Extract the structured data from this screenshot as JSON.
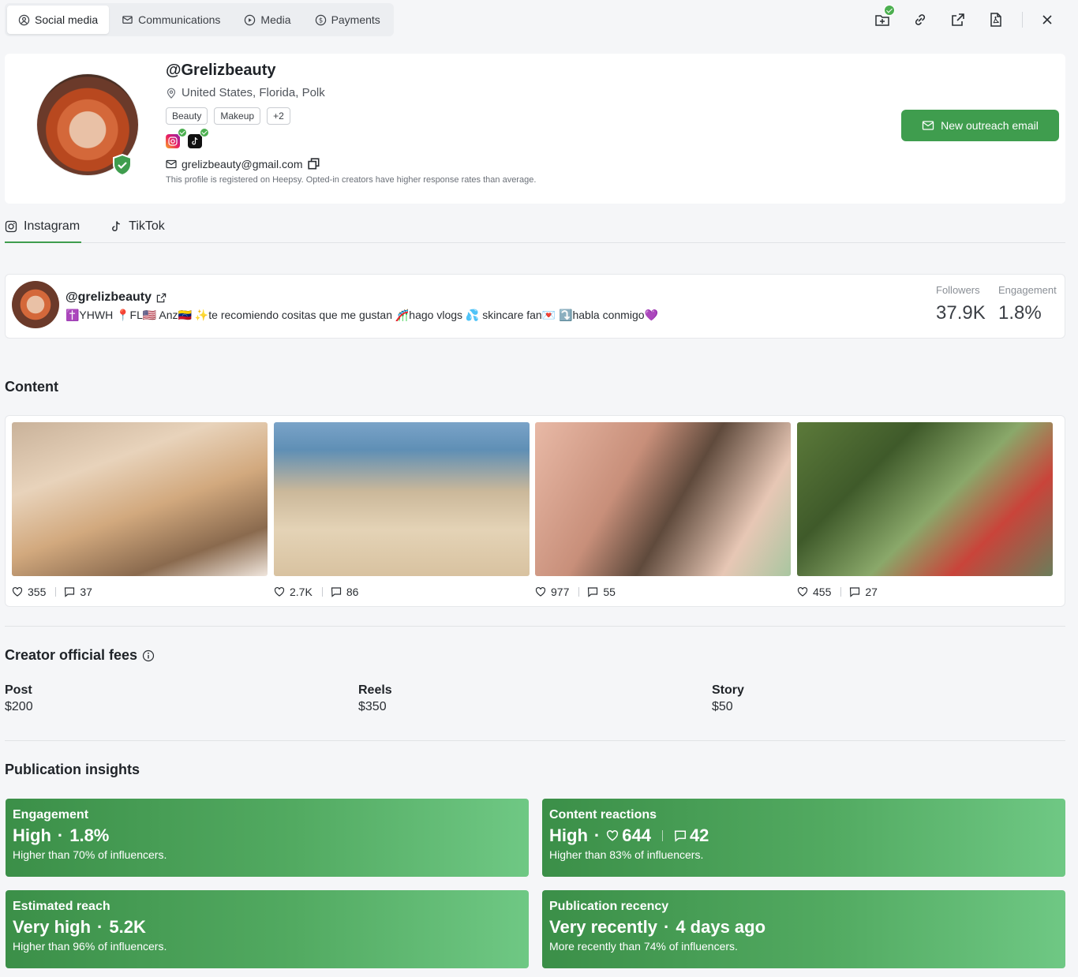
{
  "top_tabs": [
    {
      "label": "Social media",
      "icon": "social-icon",
      "active": true
    },
    {
      "label": "Communications",
      "icon": "communications-icon"
    },
    {
      "label": "Media",
      "icon": "media-play-icon"
    },
    {
      "label": "Payments",
      "icon": "dollar-icon"
    }
  ],
  "top_actions": [
    "add-to-list-icon",
    "link-icon",
    "external-link-icon",
    "pdf-export-icon",
    "close-icon"
  ],
  "profile": {
    "handle": "@Grelizbeauty",
    "location": "United States, Florida, Polk",
    "tags": [
      "Beauty",
      "Makeup",
      "+2"
    ],
    "email": "grelizbeauty@gmail.com",
    "note": "This profile is registered on Heepsy. Opted-in creators have higher response rates than average.",
    "outreach_button": "New outreach email"
  },
  "platform_tabs": [
    {
      "label": "Instagram",
      "active": true
    },
    {
      "label": "TikTok"
    }
  ],
  "account": {
    "handle": "@grelizbeauty",
    "bio": "✝️YHWH 📍FL🇺🇸 Anz🇻🇪 ✨te recomiendo cositas que me gustan 🎢hago vlogs 💦 skincare fan💌 ⤵️habla conmigo💜",
    "followers_label": "Followers",
    "followers_value": "37.9K",
    "engagement_label": "Engagement",
    "engagement_value": "1.8%"
  },
  "content": {
    "title": "Content",
    "posts": [
      {
        "likes": "355",
        "comments": "37"
      },
      {
        "likes": "2.7K",
        "comments": "86"
      },
      {
        "likes": "977",
        "comments": "55"
      },
      {
        "likes": "455",
        "comments": "27"
      }
    ]
  },
  "fees": {
    "title": "Creator official fees",
    "items": [
      {
        "name": "Post",
        "price": "$200"
      },
      {
        "name": "Reels",
        "price": "$350"
      },
      {
        "name": "Story",
        "price": "$50"
      }
    ]
  },
  "insights": {
    "title": "Publication insights",
    "engagement": {
      "title": "Engagement",
      "level": "High",
      "value": "1.8%",
      "desc": "Higher than 70% of influencers."
    },
    "reactions": {
      "title": "Content reactions",
      "level": "High",
      "likes": "644",
      "comments": "42",
      "desc": "Higher than 83% of influencers."
    },
    "reach": {
      "title": "Estimated reach",
      "level": "Very high",
      "value": "5.2K",
      "desc": "Higher than 96% of influencers."
    },
    "recency": {
      "title": "Publication recency",
      "level": "Very recently",
      "value": "4 days ago",
      "desc": "More recently than 74% of influencers."
    }
  },
  "colors": {
    "accent": "#3f9d4e",
    "background": "#f5f6f8"
  }
}
